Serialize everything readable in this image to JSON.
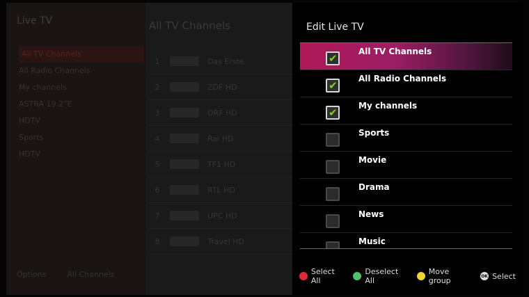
{
  "colors": {
    "red": "#e0283c",
    "green": "#4fc26a",
    "yellow": "#f0d232",
    "check": "#7ed321",
    "focus": "#b0195a"
  },
  "background": {
    "title": "Live TV",
    "header": "All TV Channels",
    "categories": [
      "All TV Channels",
      "All Radio Channels",
      "My channels",
      "ASTRA 19.2°E",
      "HDTV",
      "Sports",
      "HDTV"
    ],
    "channels": [
      {
        "num": "1",
        "name": "Das Erste"
      },
      {
        "num": "2",
        "name": "ZDF HD"
      },
      {
        "num": "3",
        "name": "ORF HD"
      },
      {
        "num": "4",
        "name": "Rai HD"
      },
      {
        "num": "5",
        "name": "TF1 HD"
      },
      {
        "num": "6",
        "name": "RTL HD"
      },
      {
        "num": "7",
        "name": "UPC HD"
      },
      {
        "num": "8",
        "name": "Travel HD"
      }
    ],
    "footer": [
      "Options",
      "All Channels"
    ]
  },
  "panel": {
    "title": "Edit Live TV",
    "items": [
      {
        "label": "All TV Channels",
        "checked": true
      },
      {
        "label": "All Radio Channels",
        "checked": true
      },
      {
        "label": "My channels",
        "checked": true
      },
      {
        "label": "Sports",
        "checked": false
      },
      {
        "label": "Movie",
        "checked": false
      },
      {
        "label": "Drama",
        "checked": false
      },
      {
        "label": "News",
        "checked": false
      },
      {
        "label": "Music",
        "checked": false
      }
    ],
    "focused_index": 0
  },
  "legend": {
    "select_all": "Select All",
    "deselect_all": "Deselect All",
    "move_group": "Move group",
    "select": "Select",
    "ok_badge": "OK"
  },
  "icons": {
    "checkmark": "✔"
  }
}
